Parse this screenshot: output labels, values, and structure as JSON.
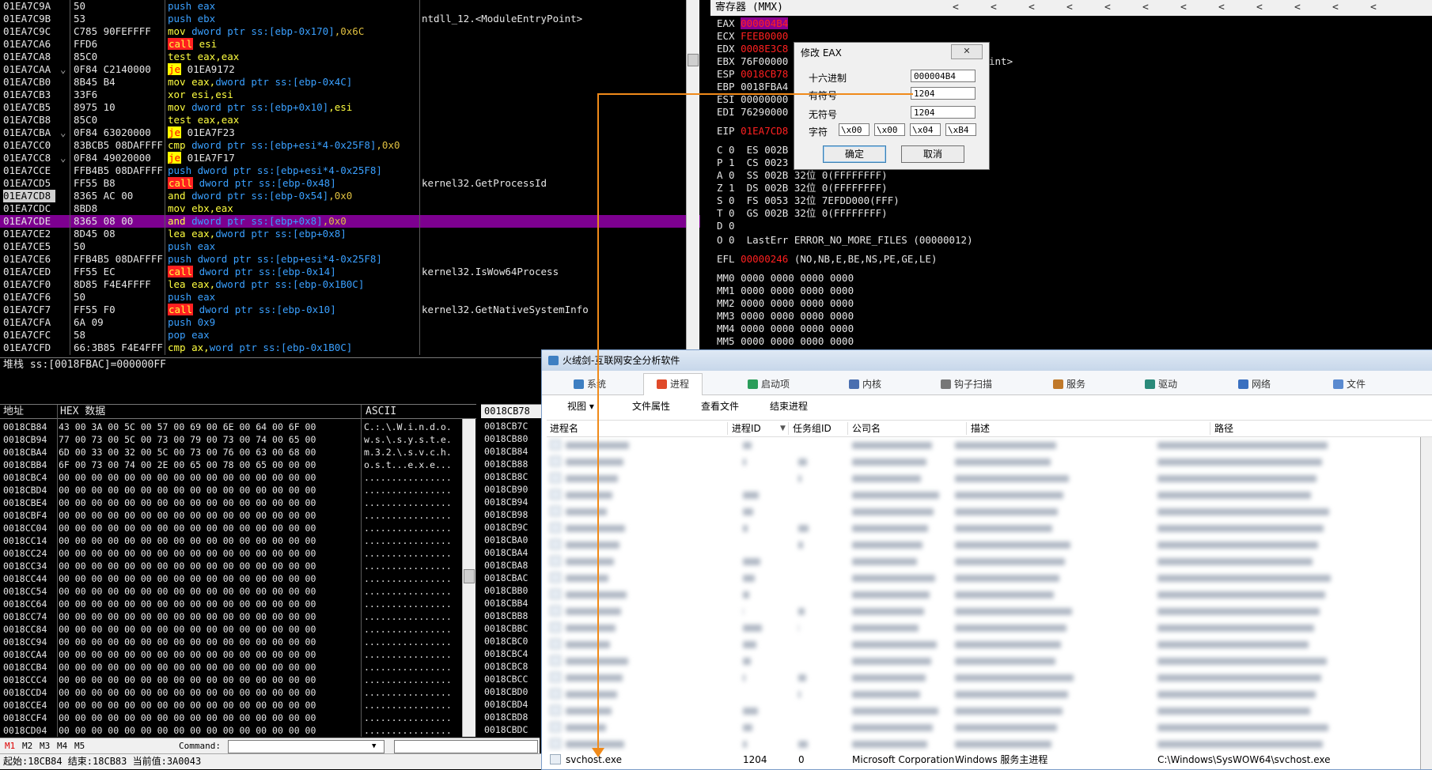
{
  "disasm": {
    "rows": [
      {
        "addr": "01EA7C9A",
        "arrow": "",
        "bytes": "50",
        "instr": [
          {
            "t": "push eax",
            "c": "blue"
          }
        ],
        "comment": ""
      },
      {
        "addr": "01EA7C9B",
        "arrow": "",
        "bytes": "53",
        "instr": [
          {
            "t": "push ebx",
            "c": "blue"
          }
        ],
        "comment": "ntdll_12.<ModuleEntryPoint>"
      },
      {
        "addr": "01EA7C9C",
        "arrow": "",
        "bytes": "C785 90FEFFFF",
        "instr": [
          {
            "t": "mov ",
            "c": "yellow"
          },
          {
            "t": "dword ptr ss:[ebp-0x170]",
            "c": "blue"
          },
          {
            "t": ",0x6C",
            "c": "orange"
          }
        ],
        "comment": ""
      },
      {
        "addr": "01EA7CA6",
        "arrow": "",
        "bytes": "FFD6",
        "instr": [
          {
            "t": "call",
            "c": "callbg"
          },
          {
            "t": " esi",
            "c": "yellow"
          }
        ],
        "comment": ""
      },
      {
        "addr": "01EA7CA8",
        "arrow": "",
        "bytes": "85C0",
        "instr": [
          {
            "t": "test eax,eax",
            "c": "yellow"
          }
        ],
        "comment": ""
      },
      {
        "addr": "01EA7CAA",
        "arrow": "⌄",
        "bytes": "0F84 C2140000",
        "instr": [
          {
            "t": "je",
            "c": "jebg"
          },
          {
            "t": " 01EA9172",
            "c": "white"
          }
        ],
        "comment": ""
      },
      {
        "addr": "01EA7CB0",
        "arrow": "",
        "bytes": "8B45 B4",
        "instr": [
          {
            "t": "mov eax,",
            "c": "yellow"
          },
          {
            "t": "dword ptr ss:[ebp-0x4C]",
            "c": "blue"
          }
        ],
        "comment": ""
      },
      {
        "addr": "01EA7CB3",
        "arrow": "",
        "bytes": "33F6",
        "instr": [
          {
            "t": "xor esi,esi",
            "c": "yellow"
          }
        ],
        "comment": ""
      },
      {
        "addr": "01EA7CB5",
        "arrow": "",
        "bytes": "8975 10",
        "instr": [
          {
            "t": "mov ",
            "c": "yellow"
          },
          {
            "t": "dword ptr ss:[ebp+0x10]",
            "c": "blue"
          },
          {
            "t": ",esi",
            "c": "yellow"
          }
        ],
        "comment": ""
      },
      {
        "addr": "01EA7CB8",
        "arrow": "",
        "bytes": "85C0",
        "instr": [
          {
            "t": "test eax,eax",
            "c": "yellow"
          }
        ],
        "comment": ""
      },
      {
        "addr": "01EA7CBA",
        "arrow": "⌄",
        "bytes": "0F84 63020000",
        "instr": [
          {
            "t": "je",
            "c": "jebg"
          },
          {
            "t": " 01EA7F23",
            "c": "white"
          }
        ],
        "comment": ""
      },
      {
        "addr": "01EA7CC0",
        "arrow": "",
        "bytes": "83BCB5 08DAFFFF",
        "instr": [
          {
            "t": "cmp ",
            "c": "yellow"
          },
          {
            "t": "dword ptr ss:[ebp+esi*4-0x25F8]",
            "c": "blue"
          },
          {
            "t": ",0x0",
            "c": "orange"
          }
        ],
        "comment": ""
      },
      {
        "addr": "01EA7CC8",
        "arrow": "⌄",
        "bytes": "0F84 49020000",
        "instr": [
          {
            "t": "je",
            "c": "jebg"
          },
          {
            "t": " 01EA7F17",
            "c": "white"
          }
        ],
        "comment": ""
      },
      {
        "addr": "01EA7CCE",
        "arrow": "",
        "bytes": "FFB4B5 08DAFFFF",
        "instr": [
          {
            "t": "push ",
            "c": "blue"
          },
          {
            "t": "dword ptr ss:[ebp+esi*4-0x25F8]",
            "c": "blue"
          }
        ],
        "comment": ""
      },
      {
        "addr": "01EA7CD5",
        "arrow": "",
        "bytes": "FF55 B8",
        "instr": [
          {
            "t": "call",
            "c": "callbg"
          },
          {
            "t": " dword ptr ss:[ebp-0x48]",
            "c": "blue"
          }
        ],
        "comment": "kernel32.GetProcessId"
      },
      {
        "addr": "01EA7CD8",
        "arrow": "",
        "bytes": "8365 AC 00",
        "instr": [
          {
            "t": "and ",
            "c": "yellow"
          },
          {
            "t": "dword ptr ss:[ebp-0x54]",
            "c": "blue"
          },
          {
            "t": ",0x0",
            "c": "orange"
          }
        ],
        "comment": "",
        "sel": true
      },
      {
        "addr": "01EA7CDC",
        "arrow": "",
        "bytes": "8BD8",
        "instr": [
          {
            "t": "mov ebx,eax",
            "c": "yellow"
          }
        ],
        "comment": ""
      },
      {
        "addr": "01EA7CDE",
        "arrow": "",
        "bytes": "8365 08 00",
        "instr": [
          {
            "t": "and ",
            "c": "yellow"
          },
          {
            "t": "dword ptr ss:[ebp+0x8]",
            "c": "blue"
          },
          {
            "t": ",0x0",
            "c": "orange"
          }
        ],
        "comment": "",
        "hl": true
      },
      {
        "addr": "01EA7CE2",
        "arrow": "",
        "bytes": "8D45 08",
        "instr": [
          {
            "t": "lea eax,",
            "c": "yellow"
          },
          {
            "t": "dword ptr ss:[ebp+0x8]",
            "c": "blue"
          }
        ],
        "comment": ""
      },
      {
        "addr": "01EA7CE5",
        "arrow": "",
        "bytes": "50",
        "instr": [
          {
            "t": "push eax",
            "c": "blue"
          }
        ],
        "comment": ""
      },
      {
        "addr": "01EA7CE6",
        "arrow": "",
        "bytes": "FFB4B5 08DAFFFF",
        "instr": [
          {
            "t": "push ",
            "c": "blue"
          },
          {
            "t": "dword ptr ss:[ebp+esi*4-0x25F8]",
            "c": "blue"
          }
        ],
        "comment": ""
      },
      {
        "addr": "01EA7CED",
        "arrow": "",
        "bytes": "FF55 EC",
        "instr": [
          {
            "t": "call",
            "c": "callbg"
          },
          {
            "t": " dword ptr ss:[ebp-0x14]",
            "c": "blue"
          }
        ],
        "comment": "kernel32.IsWow64Process"
      },
      {
        "addr": "01EA7CF0",
        "arrow": "",
        "bytes": "8D85 F4E4FFFF",
        "instr": [
          {
            "t": "lea eax,",
            "c": "yellow"
          },
          {
            "t": "dword ptr ss:[ebp-0x1B0C]",
            "c": "blue"
          }
        ],
        "comment": ""
      },
      {
        "addr": "01EA7CF6",
        "arrow": "",
        "bytes": "50",
        "instr": [
          {
            "t": "push eax",
            "c": "blue"
          }
        ],
        "comment": ""
      },
      {
        "addr": "01EA7CF7",
        "arrow": "",
        "bytes": "FF55 F0",
        "instr": [
          {
            "t": "call",
            "c": "callbg"
          },
          {
            "t": " dword ptr ss:[ebp-0x10]",
            "c": "blue"
          }
        ],
        "comment": "kernel32.GetNativeSystemInfo"
      },
      {
        "addr": "01EA7CFA",
        "arrow": "",
        "bytes": "6A 09",
        "instr": [
          {
            "t": "push 0x9",
            "c": "blue"
          }
        ],
        "comment": ""
      },
      {
        "addr": "01EA7CFC",
        "arrow": "",
        "bytes": "58",
        "instr": [
          {
            "t": "pop eax",
            "c": "blue"
          }
        ],
        "comment": ""
      },
      {
        "addr": "01EA7CFD",
        "arrow": "",
        "bytes": "66:3B85 F4E4FFFF",
        "instr": [
          {
            "t": "cmp ",
            "c": "yellow"
          },
          {
            "t": "ax,",
            "c": "yellow"
          },
          {
            "t": "word ptr ss:[ebp-0x1B0C]",
            "c": "blue"
          }
        ],
        "comment": ""
      }
    ]
  },
  "stack_info": "堆栈 ss:[0018FBAC]=000000FF",
  "hex": {
    "headers": {
      "addr": "地址",
      "data": "HEX 数据",
      "ascii": "ASCII"
    },
    "rows": [
      {
        "addr": "0018CB84",
        "bytes": "43 00 3A 00 5C 00 57 00 69 00 6E 00 64 00 6F 00",
        "ascii": "C.:.\\.W.i.n.d.o."
      },
      {
        "addr": "0018CB94",
        "bytes": "77 00 73 00 5C 00 73 00 79 00 73 00 74 00 65 00",
        "ascii": "w.s.\\.s.y.s.t.e."
      },
      {
        "addr": "0018CBA4",
        "bytes": "6D 00 33 00 32 00 5C 00 73 00 76 00 63 00 68 00",
        "ascii": "m.3.2.\\.s.v.c.h."
      },
      {
        "addr": "0018CBB4",
        "bytes": "6F 00 73 00 74 00 2E 00 65 00 78 00 65 00 00 00",
        "ascii": "o.s.t...e.x.e..."
      },
      {
        "addr": "0018CBC4",
        "bytes": "00 00 00 00 00 00 00 00 00 00 00 00 00 00 00 00",
        "ascii": "................"
      },
      {
        "addr": "0018CBD4",
        "bytes": "00 00 00 00 00 00 00 00 00 00 00 00 00 00 00 00",
        "ascii": "................"
      },
      {
        "addr": "0018CBE4",
        "bytes": "00 00 00 00 00 00 00 00 00 00 00 00 00 00 00 00",
        "ascii": "................"
      },
      {
        "addr": "0018CBF4",
        "bytes": "00 00 00 00 00 00 00 00 00 00 00 00 00 00 00 00",
        "ascii": "................"
      },
      {
        "addr": "0018CC04",
        "bytes": "00 00 00 00 00 00 00 00 00 00 00 00 00 00 00 00",
        "ascii": "................"
      },
      {
        "addr": "0018CC14",
        "bytes": "00 00 00 00 00 00 00 00 00 00 00 00 00 00 00 00",
        "ascii": "................"
      },
      {
        "addr": "0018CC24",
        "bytes": "00 00 00 00 00 00 00 00 00 00 00 00 00 00 00 00",
        "ascii": "................"
      },
      {
        "addr": "0018CC34",
        "bytes": "00 00 00 00 00 00 00 00 00 00 00 00 00 00 00 00",
        "ascii": "................"
      },
      {
        "addr": "0018CC44",
        "bytes": "00 00 00 00 00 00 00 00 00 00 00 00 00 00 00 00",
        "ascii": "................"
      },
      {
        "addr": "0018CC54",
        "bytes": "00 00 00 00 00 00 00 00 00 00 00 00 00 00 00 00",
        "ascii": "................"
      },
      {
        "addr": "0018CC64",
        "bytes": "00 00 00 00 00 00 00 00 00 00 00 00 00 00 00 00",
        "ascii": "................"
      },
      {
        "addr": "0018CC74",
        "bytes": "00 00 00 00 00 00 00 00 00 00 00 00 00 00 00 00",
        "ascii": "................"
      },
      {
        "addr": "0018CC84",
        "bytes": "00 00 00 00 00 00 00 00 00 00 00 00 00 00 00 00",
        "ascii": "................"
      },
      {
        "addr": "0018CC94",
        "bytes": "00 00 00 00 00 00 00 00 00 00 00 00 00 00 00 00",
        "ascii": "................"
      },
      {
        "addr": "0018CCA4",
        "bytes": "00 00 00 00 00 00 00 00 00 00 00 00 00 00 00 00",
        "ascii": "................"
      },
      {
        "addr": "0018CCB4",
        "bytes": "00 00 00 00 00 00 00 00 00 00 00 00 00 00 00 00",
        "ascii": "................"
      },
      {
        "addr": "0018CCC4",
        "bytes": "00 00 00 00 00 00 00 00 00 00 00 00 00 00 00 00",
        "ascii": "................"
      },
      {
        "addr": "0018CCD4",
        "bytes": "00 00 00 00 00 00 00 00 00 00 00 00 00 00 00 00",
        "ascii": "................"
      },
      {
        "addr": "0018CCE4",
        "bytes": "00 00 00 00 00 00 00 00 00 00 00 00 00 00 00 00",
        "ascii": "................"
      },
      {
        "addr": "0018CCF4",
        "bytes": "00 00 00 00 00 00 00 00 00 00 00 00 00 00 00 00",
        "ascii": "................"
      },
      {
        "addr": "0018CD04",
        "bytes": "00 00 00 00 00 00 00 00 00 00 00 00 00 00 00 00",
        "ascii": "................"
      }
    ]
  },
  "stack": {
    "header": "0018CB78",
    "rows": [
      "0018CB7C",
      "0018CB80",
      "0018CB84",
      "0018CB88",
      "0018CB8C",
      "0018CB90",
      "0018CB94",
      "0018CB98",
      "0018CB9C",
      "0018CBA0",
      "0018CBA4",
      "0018CBA8",
      "0018CBAC",
      "0018CBB0",
      "0018CBB4",
      "0018CBB8",
      "0018CBBC",
      "0018CBC0",
      "0018CBC4",
      "0018CBC8",
      "0018CBCC",
      "0018CBD0",
      "0018CBD4",
      "0018CBD8",
      "0018CBDC"
    ]
  },
  "cmdbar": {
    "tabs": [
      "M1",
      "M2",
      "M3",
      "M4",
      "M5"
    ],
    "label": "Command:"
  },
  "status": "起始:18CB84 结束:18CB83 当前值:3A0043",
  "registers": {
    "title": "寄存器 (MMX)",
    "lines": [
      {
        "name": "EAX",
        "value": "000004B4",
        "style": "sel",
        "rest": ""
      },
      {
        "name": "ECX",
        "value": "FEEB0000",
        "style": "red",
        "rest": ""
      },
      {
        "name": "EDX",
        "value": "0008E3C8",
        "style": "red",
        "rest": ""
      },
      {
        "name": "EBX",
        "value": "76F00000",
        "style": "",
        "rest": ""
      },
      {
        "name": "ESP",
        "value": "0018CB78",
        "style": "red",
        "rest": ""
      },
      {
        "name": "EBP",
        "value": "0018FBA4",
        "style": "",
        "rest": ""
      },
      {
        "name": "ESI",
        "value": "00000000",
        "style": "",
        "rest": ""
      },
      {
        "name": "EDI",
        "value": "76290000",
        "style": "",
        "rest": ""
      },
      {
        "name": "EIP",
        "value": "01EA7CD8",
        "style": "red",
        "rest": ""
      }
    ],
    "ebx_tail": "int>",
    "flags": [
      "C 0  ES 002B",
      "P 1  CS 0023",
      "A 0  SS 002B 32位 0(FFFFFFFF)",
      "Z 1  DS 002B 32位 0(FFFFFFFF)",
      "S 0  FS 0053 32位 7EFDD000(FFF)",
      "T 0  GS 002B 32位 0(FFFFFFFF)",
      "D 0",
      "O 0  LastErr ERROR_NO_MORE_FILES (00000012)"
    ],
    "efl_name": "EFL",
    "efl_value": "00000246",
    "efl_rest": " (NO,NB,E,BE,NS,PE,GE,LE)",
    "mmx": [
      "MM0 0000 0000 0000 0000",
      "MM1 0000 0000 0000 0000",
      "MM2 0000 0000 0000 0000",
      "MM3 0000 0000 0000 0000",
      "MM4 0000 0000 0000 0000",
      "MM5 0000 0000 0000 0000"
    ]
  },
  "dialog": {
    "title": "修改 EAX",
    "hex_label": "十六进制",
    "hex_value": "000004B4",
    "signed_label": "有符号",
    "signed_value": "1204",
    "unsigned_label": "无符号",
    "unsigned_value": "1204",
    "char_label": "字符",
    "chars": [
      "\\x00",
      "\\x00",
      "\\x04",
      "\\xB4"
    ],
    "ok": "确定",
    "cancel": "取消"
  },
  "huorong": {
    "title": "火绒剑-互联网安全分析软件",
    "tabs": [
      {
        "label": "系统",
        "color": "#3e7fc2"
      },
      {
        "label": "进程",
        "color": "#e04a2a",
        "active": true
      },
      {
        "label": "启动项",
        "color": "#2a9d5a"
      },
      {
        "label": "内核",
        "color": "#4a6fb0"
      },
      {
        "label": "钩子扫描",
        "color": "#777777"
      },
      {
        "label": "服务",
        "color": "#c0792a"
      },
      {
        "label": "驱动",
        "color": "#2a8a7a"
      },
      {
        "label": "网络",
        "color": "#3a70c0"
      },
      {
        "label": "文件",
        "color": "#5a8ad0"
      }
    ],
    "toolbar": [
      "视图 ▾",
      "文件属性",
      "查看文件",
      "结束进程"
    ],
    "columns": [
      "进程名",
      "进程ID",
      "任务组ID",
      "公司名",
      "描述",
      "路径"
    ],
    "blurred_rows": 19,
    "last_row": {
      "name": "svchost.exe",
      "pid": "1204",
      "tgid": "0",
      "company": "Microsoft Corporation",
      "desc": "Windows 服务主进程",
      "path": "C:\\Windows\\SysWOW64\\svchost.exe"
    }
  }
}
